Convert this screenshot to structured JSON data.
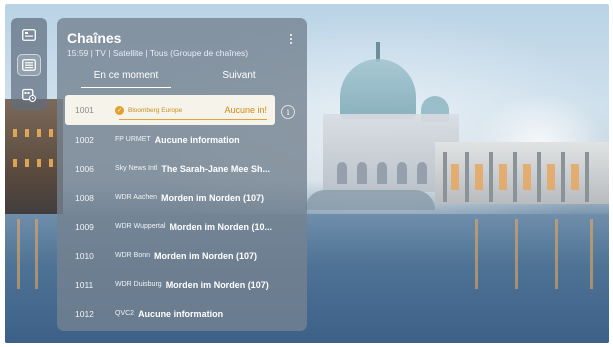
{
  "panel": {
    "title": "Chaînes",
    "subtitle": "15:59 | TV | Satellite | Tous (Groupe de chaînes)",
    "tabs": [
      {
        "label": "En ce moment",
        "active": true
      },
      {
        "label": "Suivant",
        "active": false
      }
    ]
  },
  "channels": [
    {
      "number": "1001",
      "name": "Bloomberg Europe",
      "program": "Aucune in!",
      "selected": true
    },
    {
      "number": "1002",
      "name": "FP URMET",
      "program": "Aucune information",
      "selected": false
    },
    {
      "number": "1006",
      "name": "Sky News Intl",
      "program": "The Sarah-Jane Mee Sh...",
      "selected": false
    },
    {
      "number": "1008",
      "name": "WDR Aachen",
      "program": "Morden im Norden (107)",
      "selected": false
    },
    {
      "number": "1009",
      "name": "WDR Wuppertal",
      "program": "Morden im Norden (10...",
      "selected": false
    },
    {
      "number": "1010",
      "name": "WDR Bonn",
      "program": "Morden im Norden (107)",
      "selected": false
    },
    {
      "number": "1011",
      "name": "WDR Duisburg",
      "program": "Morden im Norden (107)",
      "selected": false
    },
    {
      "number": "1012",
      "name": "QVC2",
      "program": "Aucune information",
      "selected": false
    }
  ],
  "rail": {
    "items": [
      {
        "icon": "tv-guide-icon",
        "active": false
      },
      {
        "icon": "channel-list-icon",
        "active": true
      },
      {
        "icon": "schedule-icon",
        "active": false
      }
    ]
  },
  "colors": {
    "accent": "#e2a12f",
    "selected_row": "#f6f3ea",
    "panel": "#748290"
  }
}
